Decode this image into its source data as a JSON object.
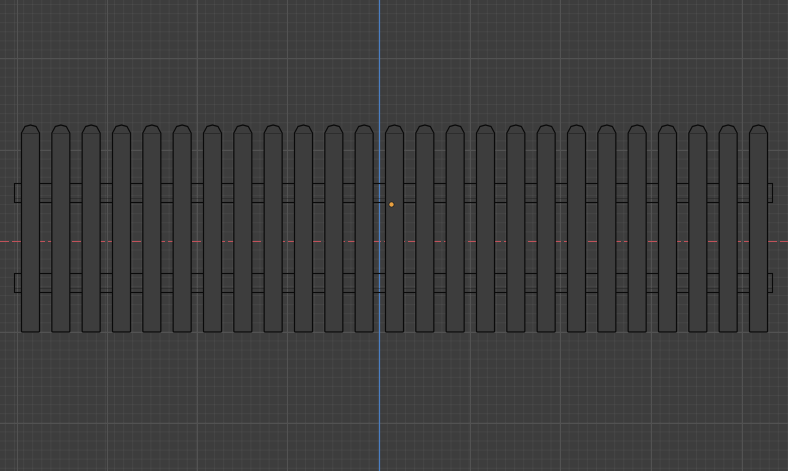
{
  "viewport": {
    "mode": "orthographic-front",
    "background_color": "#3d3d3d",
    "grid_minor_color": "#454545",
    "grid_major_color": "#525252",
    "axis_x_color": "#c0525a",
    "axis_z_color": "#4a7fc4",
    "origin_color": "#e8a040",
    "wireframe_color": "#0a0a0a",
    "picket_fill_color": "#3d3d3d",
    "icons": {
      "object_origin": "origin-dot-icon"
    }
  },
  "fence": {
    "object_type": "picket-fence",
    "picket_count": 25,
    "rail_count": 2,
    "selected": false
  }
}
